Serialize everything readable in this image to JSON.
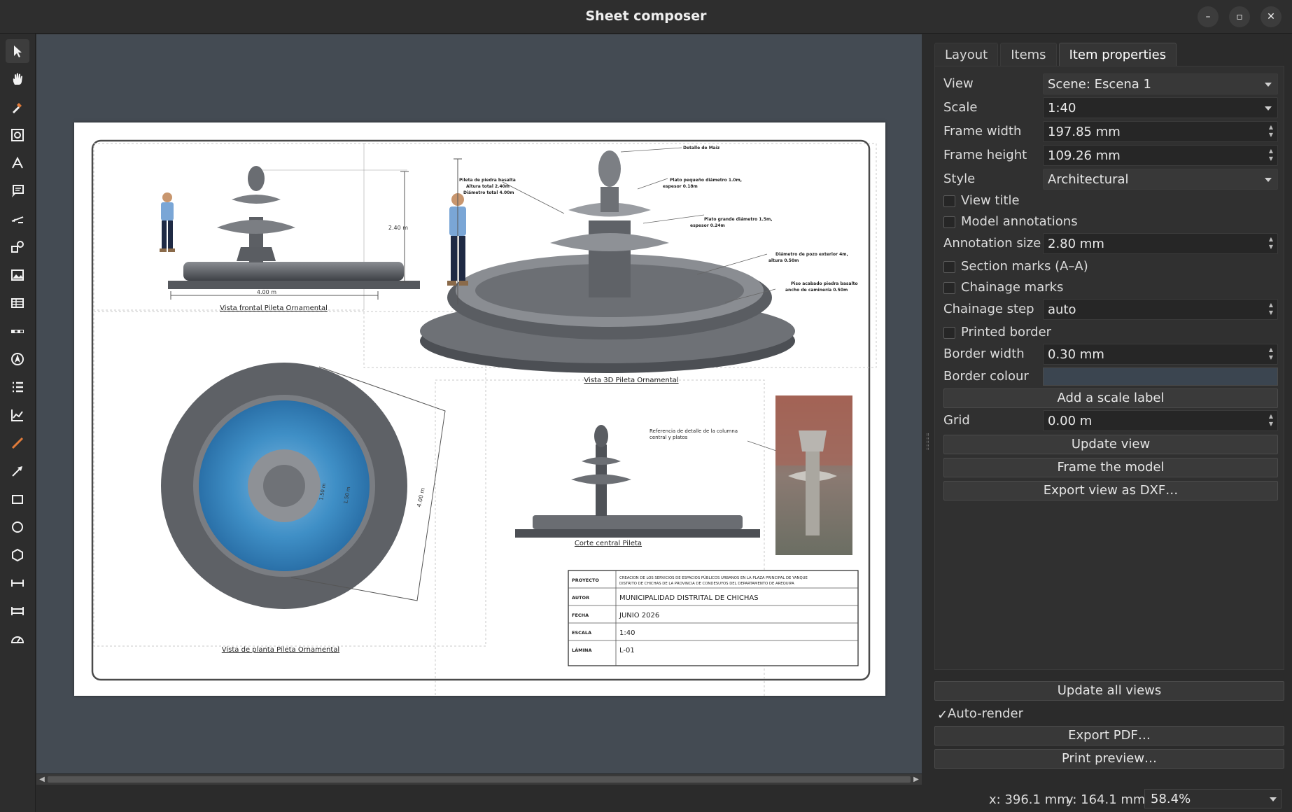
{
  "window": {
    "title": "Sheet composer",
    "minimize_glyph": "–",
    "maximize_glyph": "▫",
    "close_glyph": "✕"
  },
  "toolbar": {
    "tools": [
      "select-icon",
      "pan-hand-icon",
      "pick-view-icon",
      "view-icon",
      "dimension-icon",
      "annotation-icon",
      "leader-icon",
      "section-icon",
      "image-icon",
      "table-icon",
      "scale-bar-icon",
      "north-arrow-icon",
      "legend-icon",
      "chart-icon",
      "line-icon",
      "arrow-icon",
      "rectangle-icon",
      "circle-icon",
      "polygon-icon",
      "linear-dimension-icon",
      "chain-dimension-icon",
      "gauge-icon"
    ]
  },
  "sheet": {
    "views": {
      "front_title": "Vista frontal Pileta Ornamental",
      "iso_title": "Vista 3D Pileta Ornamental",
      "plan_title": "Vista de planta Pileta Ornamental",
      "section_title": "Corte central Pileta"
    },
    "dims": {
      "front_width": "4.00 m",
      "front_height": "2.40 m",
      "plan_diameter": "4.00 m",
      "plan_inner_a": "1.50 m",
      "plan_inner_b": "1.50 m"
    },
    "notes": {
      "maiz": "Detalle de Maiz",
      "pileta_l1": "Pileta de piedra basalta",
      "pileta_l2": "Altura total 2.40m",
      "pileta_l3": "Diámetro total 4.00m",
      "plato_peq_l1": "Plato pequeño diámetro 1.0m,",
      "plato_peq_l2": "espesor 0.18m",
      "plato_gr_l1": "Plato grande diámetro 1.5m,",
      "plato_gr_l2": "espesor 0.24m",
      "pozo_l1": "Diámetro de pozo exterior 4m,",
      "pozo_l2": "altura 0.50m",
      "piso_l1": "Piso acabado piedra basalto",
      "piso_l2": "ancho de caminería 0.50m",
      "ref_l1": "Referencia de detalle de la columna",
      "ref_l2": "central y platos"
    },
    "title_block": {
      "proyecto_label": "PROYECTO",
      "proyecto_l1": "CREACION DE LOS SERVICIOS DE ESPACIOS PÚBLICOS URBANOS EN LA PLAZA PRINCIPAL DE YANQUE",
      "proyecto_l2": "DISTRITO DE CHICHAS DE LA PROVINCIA DE CONDESUYOS DEL DEPARTAMENTO DE AREQUIPA",
      "autor_label": "AUTOR",
      "autor": "MUNICIPALIDAD DISTRITAL DE CHICHAS",
      "fecha_label": "FECHA",
      "fecha": "JUNIO 2026",
      "escala_label": "ESCALA",
      "escala": "1:40",
      "lamina_label": "LÁMINA",
      "lamina": "L-01"
    }
  },
  "panel": {
    "tabs": [
      "Layout",
      "Items",
      "Item properties"
    ],
    "active_tab": "Item properties",
    "view_label": "View",
    "view_value": "Scene: Escena 1",
    "scale_label": "Scale",
    "scale_value": "1:40",
    "frame_width_label": "Frame width",
    "frame_width_value": "197.85 mm",
    "frame_height_label": "Frame height",
    "frame_height_value": "109.26 mm",
    "style_label": "Style",
    "style_value": "Architectural",
    "view_title_label": "View title",
    "model_annotations_label": "Model annotations",
    "annotation_size_label": "Annotation size",
    "annotation_size_value": "2.80 mm",
    "section_marks_label": "Section marks (A–A)",
    "chainage_marks_label": "Chainage marks",
    "chainage_step_label": "Chainage step",
    "chainage_step_value": "auto",
    "printed_border_label": "Printed border",
    "border_width_label": "Border width",
    "border_width_value": "0.30 mm",
    "border_colour_label": "Border colour",
    "border_colour_value": "#3b4550",
    "add_scale_label_btn": "Add a scale label",
    "grid_label": "Grid",
    "grid_value": "0.00 m",
    "update_view_btn": "Update view",
    "frame_model_btn": "Frame the model",
    "export_dxf_btn": "Export view as DXF…",
    "update_all_btn": "Update all views",
    "auto_render_label": "Auto-render",
    "auto_render_checked": true,
    "export_pdf_btn": "Export PDF…",
    "print_preview_btn": "Print preview…"
  },
  "status": {
    "x": "x: 396.1 mm",
    "y": "y: 164.1 mm",
    "zoom": "58.4%"
  }
}
